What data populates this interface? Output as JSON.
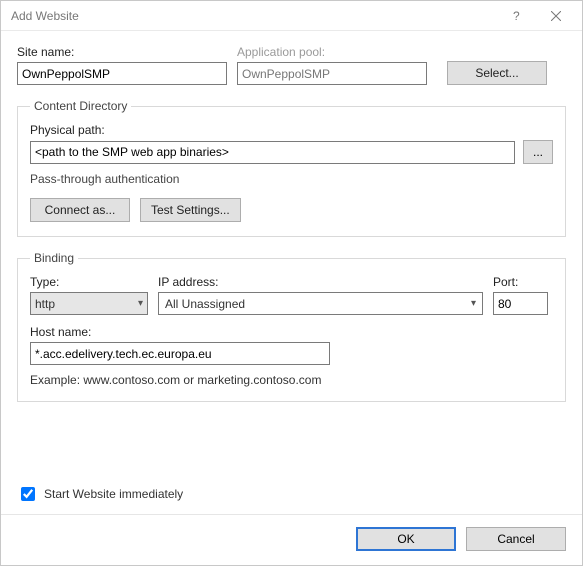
{
  "titlebar": {
    "title": "Add Website"
  },
  "siteName": {
    "label": "Site name:",
    "value": "OwnPeppolSMP"
  },
  "appPool": {
    "label": "Application pool:",
    "value": "OwnPeppolSMP",
    "selectLabel": "Select..."
  },
  "contentDir": {
    "legend": "Content Directory",
    "physicalPathLabel": "Physical path:",
    "physicalPathValue": "<path to the SMP web app binaries>",
    "browseLabel": "...",
    "authText": "Pass-through authentication",
    "connectAs": "Connect as...",
    "testSettings": "Test Settings..."
  },
  "binding": {
    "legend": "Binding",
    "typeLabel": "Type:",
    "typeValue": "http",
    "ipLabel": "IP address:",
    "ipValue": "All Unassigned",
    "portLabel": "Port:",
    "portValue": "80",
    "hostLabel": "Host name:",
    "hostValue": "*.acc.edelivery.tech.ec.europa.eu",
    "example": "Example: www.contoso.com or marketing.contoso.com"
  },
  "startImmediate": {
    "label": "Start Website immediately"
  },
  "footer": {
    "ok": "OK",
    "cancel": "Cancel"
  }
}
